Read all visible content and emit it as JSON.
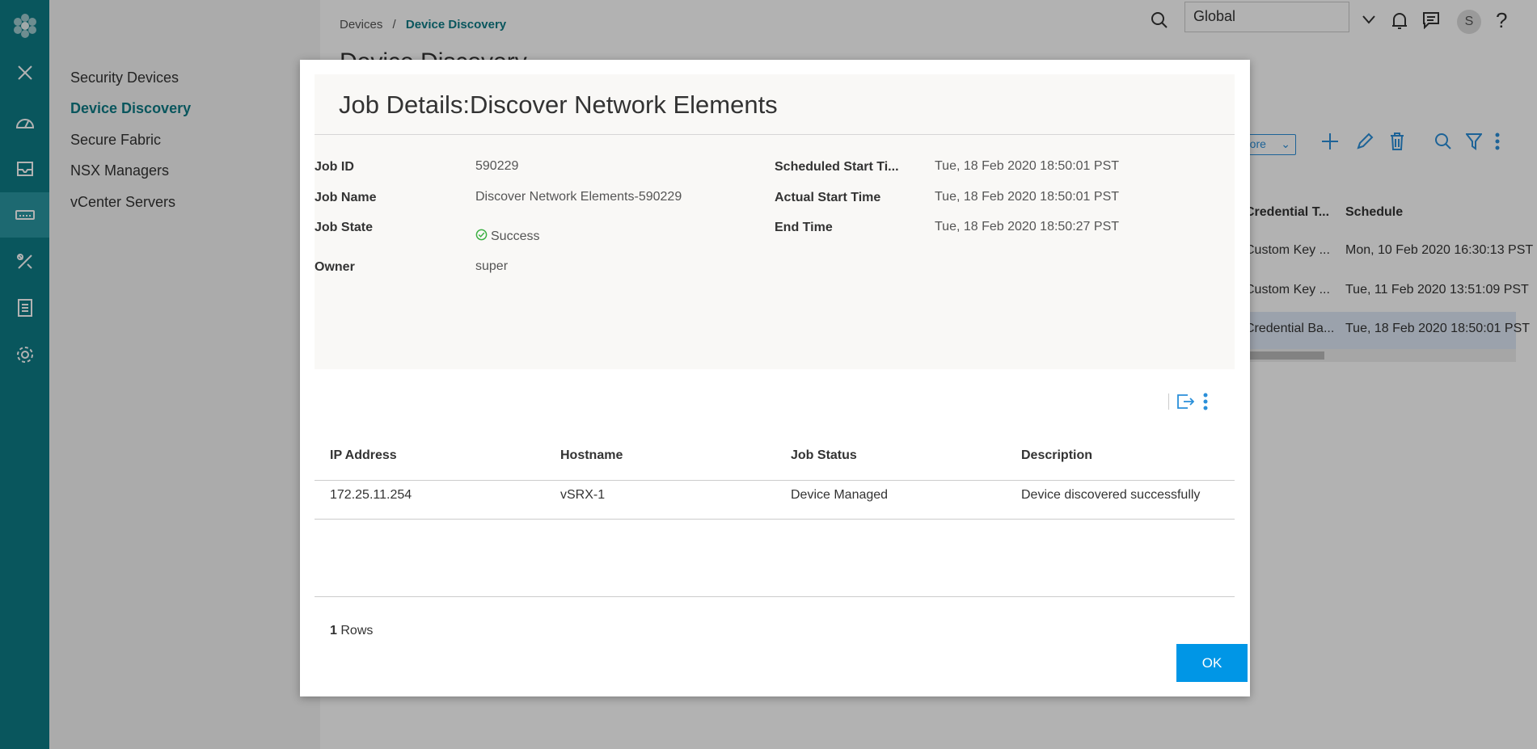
{
  "rail": {
    "icons": [
      "logo-icon",
      "close-icon",
      "dashboard-icon",
      "monitor-icon",
      "devices-icon",
      "tools-icon",
      "reports-icon",
      "settings-icon"
    ]
  },
  "subnav": {
    "items": [
      {
        "label": "Security Devices"
      },
      {
        "label": "Device Discovery"
      },
      {
        "label": "Secure Fabric"
      },
      {
        "label": "NSX Managers"
      },
      {
        "label": "vCenter Servers"
      }
    ]
  },
  "breadcrumb": {
    "parent": "Devices",
    "separator": "/",
    "current": "Device Discovery"
  },
  "page": {
    "title": "Device Discovery"
  },
  "topbar": {
    "domain": "Global",
    "avatar_initial": "S",
    "help": "?"
  },
  "bg_table": {
    "more_label": "More",
    "columns": [
      "Credential T...",
      "Schedule"
    ],
    "rows": [
      [
        "Custom Key ...",
        "Mon, 10 Feb 2020 16:30:13 PST"
      ],
      [
        "Custom Key ...",
        "Tue, 11 Feb 2020 13:51:09 PST"
      ],
      [
        "Credential Ba...",
        "Tue, 18 Feb 2020 18:50:01 PST"
      ]
    ]
  },
  "modal": {
    "title": "Job Details:Discover Network Elements",
    "fields": {
      "job_id_label": "Job ID",
      "job_id": "590229",
      "job_name_label": "Job Name",
      "job_name": "Discover Network Elements-590229",
      "job_state_label": "Job State",
      "job_state": "Success",
      "owner_label": "Owner",
      "owner": "super",
      "scheduled_start_label": "Scheduled Start Ti...",
      "scheduled_start": "Tue, 18 Feb 2020 18:50:01 PST",
      "actual_start_label": "Actual Start Time",
      "actual_start": "Tue, 18 Feb 2020 18:50:01 PST",
      "end_time_label": "End Time",
      "end_time": "Tue, 18 Feb 2020 18:50:27 PST"
    },
    "grid": {
      "columns": [
        "IP Address",
        "Hostname",
        "Job Status",
        "Description"
      ],
      "rows": [
        [
          "172.25.11.254",
          "vSRX-1",
          "Device Managed",
          "Device discovered successfully"
        ]
      ],
      "row_count": "1",
      "row_count_suffix": "Rows"
    },
    "ok_label": "OK"
  },
  "colors": {
    "rail": "#0e7b86",
    "accent": "#0096e6",
    "success": "#3cb043"
  }
}
